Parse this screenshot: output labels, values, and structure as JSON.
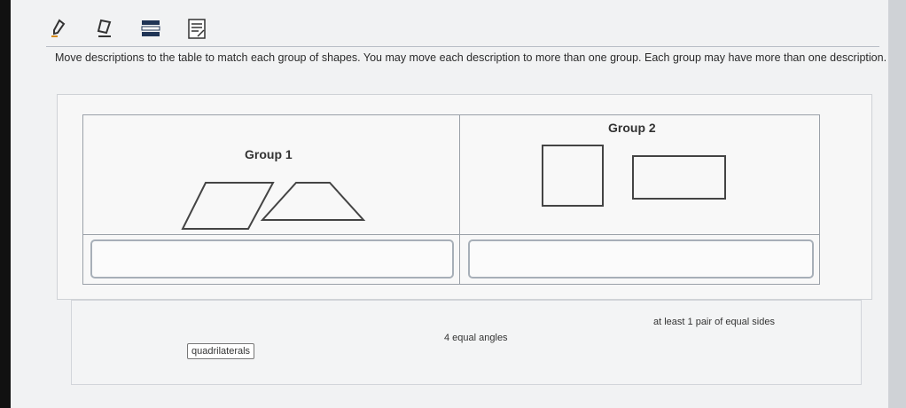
{
  "toolbar": {
    "tools": [
      {
        "icon": "pencil-icon"
      },
      {
        "icon": "eraser-icon"
      },
      {
        "icon": "line-reader-icon"
      },
      {
        "icon": "notepad-icon"
      }
    ]
  },
  "instructions": "Move descriptions to the table to match each group of shapes. You may move each description to more than one group. Each group may have more than one description.",
  "table": {
    "group1_label": "Group 1",
    "group2_label": "Group 2",
    "group1_shapes": [
      "parallelogram",
      "trapezoid"
    ],
    "group2_shapes": [
      "square",
      "rectangle"
    ]
  },
  "bank": {
    "items": [
      {
        "label": "quadrilaterals"
      },
      {
        "label": "4 equal angles"
      },
      {
        "label": "at least 1 pair of equal sides"
      }
    ]
  },
  "colors": {
    "border": "#9aa0a8",
    "shape_stroke": "#444444",
    "drop_zone_border": "#a7afb8"
  }
}
